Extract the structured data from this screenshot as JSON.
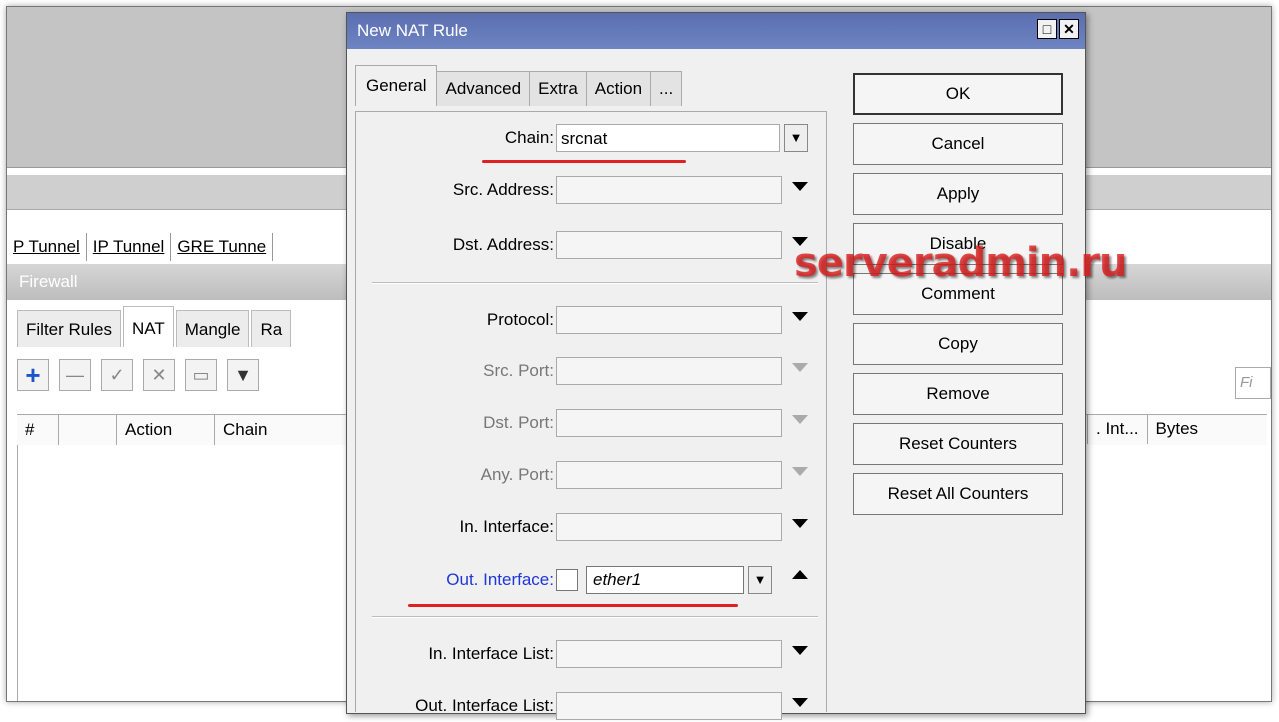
{
  "background": {
    "interface_tabs": [
      "P Tunnel",
      "IP Tunnel",
      "GRE Tunne"
    ],
    "firewall_title": "Firewall",
    "firewall_tabs": [
      {
        "label": "Filter Rules",
        "active": false
      },
      {
        "label": "NAT",
        "active": true
      },
      {
        "label": "Mangle",
        "active": false
      },
      {
        "label": "Ra",
        "active": false
      }
    ],
    "find_placeholder": "Fi",
    "columns": [
      "#",
      "",
      "Action",
      "Chain"
    ],
    "columns_right": [
      ". Int...",
      "Bytes"
    ]
  },
  "dialog": {
    "title": "New NAT Rule",
    "tabs": [
      {
        "label": "General",
        "active": true
      },
      {
        "label": "Advanced",
        "active": false
      },
      {
        "label": "Extra",
        "active": false
      },
      {
        "label": "Action",
        "active": false
      },
      {
        "label": "...",
        "active": false
      }
    ],
    "fields": {
      "chain": {
        "label": "Chain:",
        "value": "srcnat"
      },
      "src_address": {
        "label": "Src. Address:"
      },
      "dst_address": {
        "label": "Dst. Address:"
      },
      "protocol": {
        "label": "Protocol:"
      },
      "src_port": {
        "label": "Src. Port:"
      },
      "dst_port": {
        "label": "Dst. Port:"
      },
      "any_port": {
        "label": "Any. Port:"
      },
      "in_interface": {
        "label": "In. Interface:"
      },
      "out_interface": {
        "label": "Out. Interface:",
        "value": "ether1",
        "negated": false
      },
      "in_interface_list": {
        "label": "In. Interface List:"
      },
      "out_interface_list": {
        "label": "Out. Interface List:"
      }
    },
    "buttons": {
      "ok": "OK",
      "cancel": "Cancel",
      "apply": "Apply",
      "disable": "Disable",
      "comment": "Comment",
      "copy": "Copy",
      "remove": "Remove",
      "reset_counters": "Reset Counters",
      "reset_all_counters": "Reset All Counters"
    }
  },
  "watermark": "serveradmin.ru",
  "colors": {
    "title_bar": "#6a7fb6",
    "highlight_label": "#1f36d8",
    "annotation_underline": "#e02020",
    "watermark": "#dc1e1e"
  }
}
